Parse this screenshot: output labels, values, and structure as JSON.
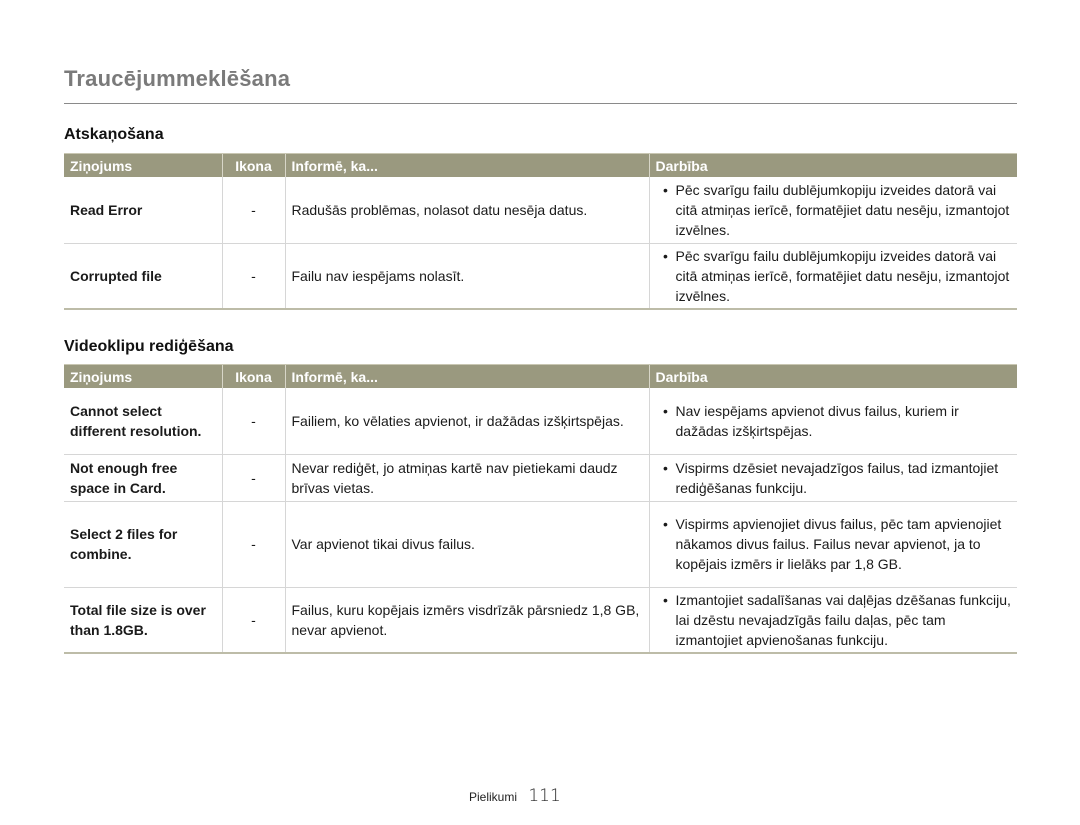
{
  "page": {
    "title": "Traucējummeklēšana",
    "footer": {
      "section": "Pielikumi",
      "page_number": "111"
    }
  },
  "columns": {
    "message": "Ziņojums",
    "icon": "Ikona",
    "info": "Informē, ka...",
    "action": "Darbība"
  },
  "sections": [
    {
      "title": "Atskaņošana",
      "rows": [
        {
          "message": "Read Error",
          "icon": "-",
          "info": "Radušās problēmas, nolasot datu nesēja datus.",
          "action": "Pēc svarīgu failu dublējumkopiju izveides datorā vai citā atmiņas ierīcē, formatējiet datu nesēju, izmantojot izvēlnes."
        },
        {
          "message": "Corrupted file",
          "icon": "-",
          "info": "Failu nav iespējams nolasīt.",
          "action": "Pēc svarīgu failu dublējumkopiju izveides datorā vai citā atmiņas ierīcē, formatējiet datu nesēju, izmantojot izvēlnes."
        }
      ]
    },
    {
      "title": "Videoklipu rediģēšana",
      "rows": [
        {
          "message": "Cannot select different resolution.",
          "icon": "-",
          "info": "Failiem, ko vēlaties apvienot, ir dažādas izšķirtspējas.",
          "action": "Nav iespējams apvienot divus failus, kuriem ir dažādas izšķirtspējas."
        },
        {
          "message": "Not enough free space in Card.",
          "icon": "-",
          "info": "Nevar rediģēt, jo atmiņas kartē nav pietiekami daudz brīvas vietas.",
          "action": "Vispirms dzēsiet nevajadzīgos failus, tad izmantojiet rediģēšanas funkciju."
        },
        {
          "message": "Select 2 files for combine.",
          "icon": "-",
          "info": "Var apvienot tikai divus failus.",
          "action": "Vispirms apvienojiet divus failus, pēc tam apvienojiet nākamos divus failus. Failus nevar apvienot, ja to kopējais izmērs ir lielāks par 1,8 GB."
        },
        {
          "message": "Total file size is over than 1.8GB.",
          "icon": "-",
          "info": "Failus, kuru kopējais izmērs visdrīzāk pārsniedz 1,8 GB, nevar apvienot.",
          "action": "Izmantojiet sadalīšanas vai daļējas dzēšanas funkciju, lai dzēstu nevajadzīgās failu daļas, pēc tam izmantojiet apvienošanas funkciju."
        }
      ]
    }
  ],
  "colors": {
    "header_bg": "#9a997f",
    "title": "#7a7a7a"
  }
}
